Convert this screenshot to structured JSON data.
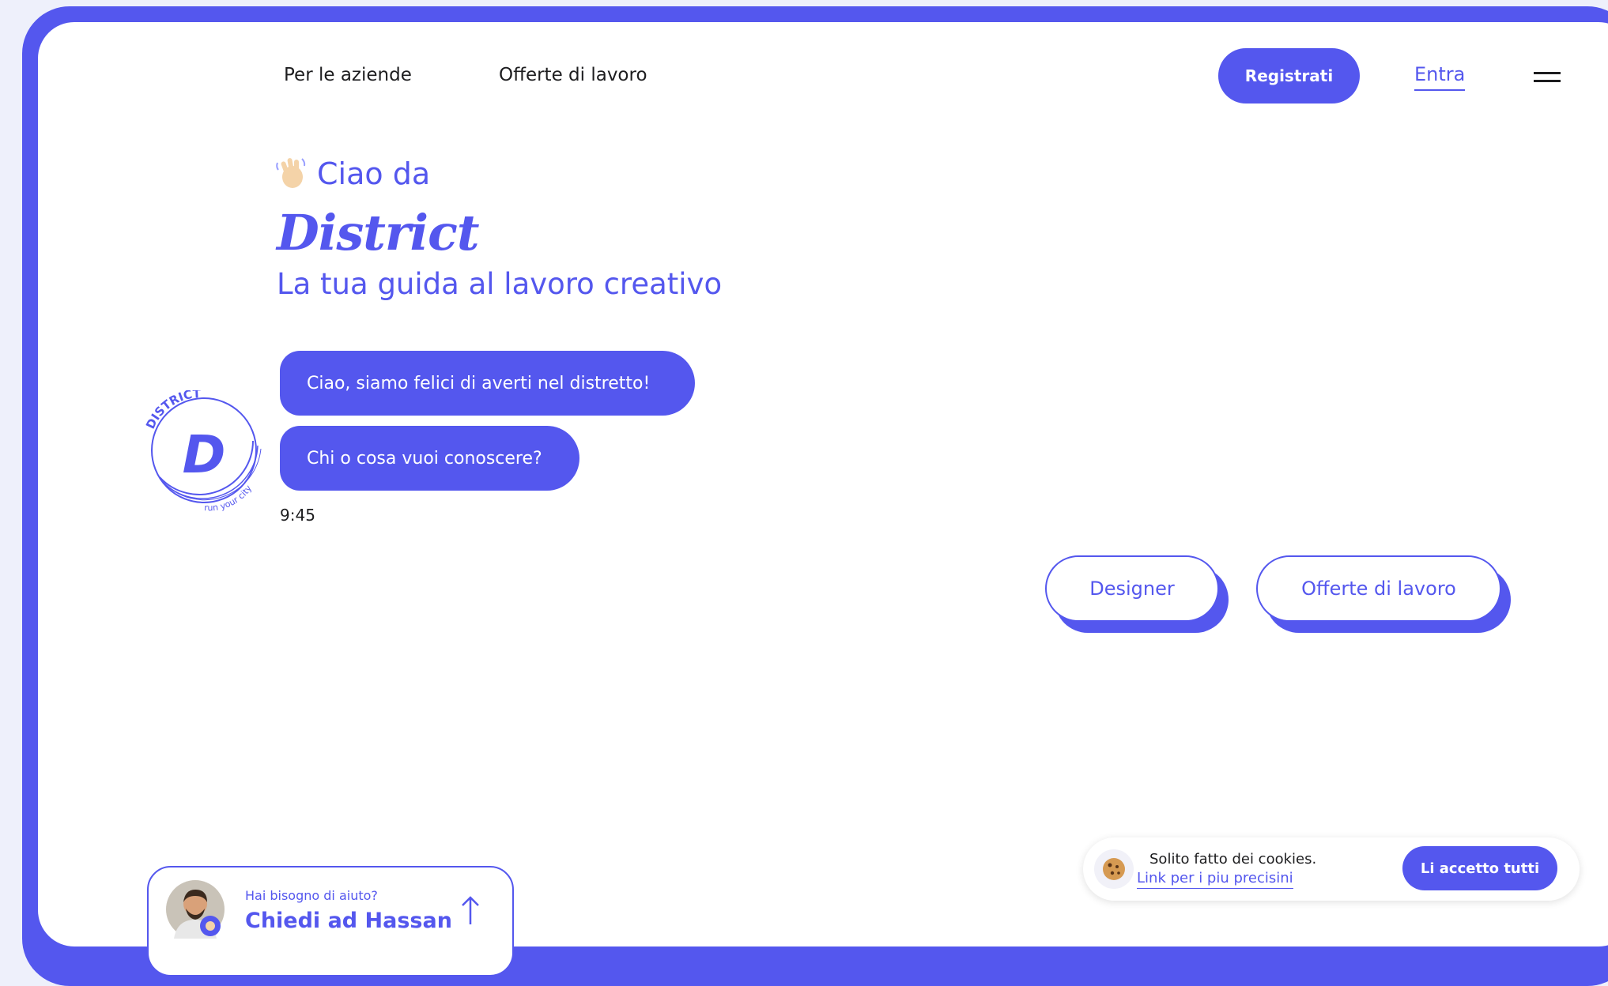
{
  "nav": {
    "for_companies": "Per le aziende",
    "job_offers": "Offerte di lavoro",
    "register": "Registrati",
    "login": "Entra"
  },
  "hero": {
    "greeting": "Ciao da",
    "brand": "District",
    "tagline": "La tua guida al lavoro creativo"
  },
  "logo": {
    "arc_top": "DISTRICT",
    "letter": "D",
    "arc_bottom": "run your city"
  },
  "chat": {
    "messages": [
      "Ciao, siamo felici di averti nel distretto!",
      "Chi o cosa vuoi conoscere?"
    ],
    "time": "9:45",
    "options": [
      "Designer",
      "Offerte di lavoro"
    ]
  },
  "help": {
    "question": "Hai bisogno di aiuto?",
    "cta": "Chiedi ad Hassan"
  },
  "cookies": {
    "text": "Solito fatto dei cookies.",
    "link": "Link per i piu precisini",
    "accept": "Li accetto tutti"
  },
  "colors": {
    "accent": "#5457ee",
    "text": "#1d1d1f",
    "background": "#ffffff"
  },
  "icons": [
    "waving-hand-icon",
    "menu-icon",
    "arrow-up-icon",
    "cookie-icon"
  ]
}
